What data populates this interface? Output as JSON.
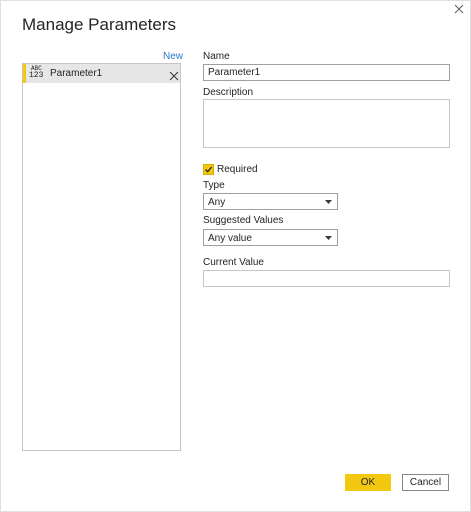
{
  "dialog": {
    "title": "Manage Parameters",
    "close_icon": "close-icon"
  },
  "list": {
    "new_label": "New",
    "items": [
      {
        "type_badge_top": "ABC",
        "type_badge_bottom": "123",
        "name": "Parameter1",
        "remove_icon": "close-icon"
      }
    ]
  },
  "form": {
    "name_label": "Name",
    "name_value": "Parameter1",
    "description_label": "Description",
    "description_value": "",
    "required_label": "Required",
    "required_checked": true,
    "type_label": "Type",
    "type_value": "Any",
    "suggested_label": "Suggested Values",
    "suggested_value": "Any value",
    "current_label": "Current Value",
    "current_value": ""
  },
  "footer": {
    "ok_label": "OK",
    "cancel_label": "Cancel"
  },
  "colors": {
    "accent": "#f2c811",
    "link": "#2b78c5",
    "selected_row": "#e6e6e6",
    "border": "#c8c6c4"
  }
}
